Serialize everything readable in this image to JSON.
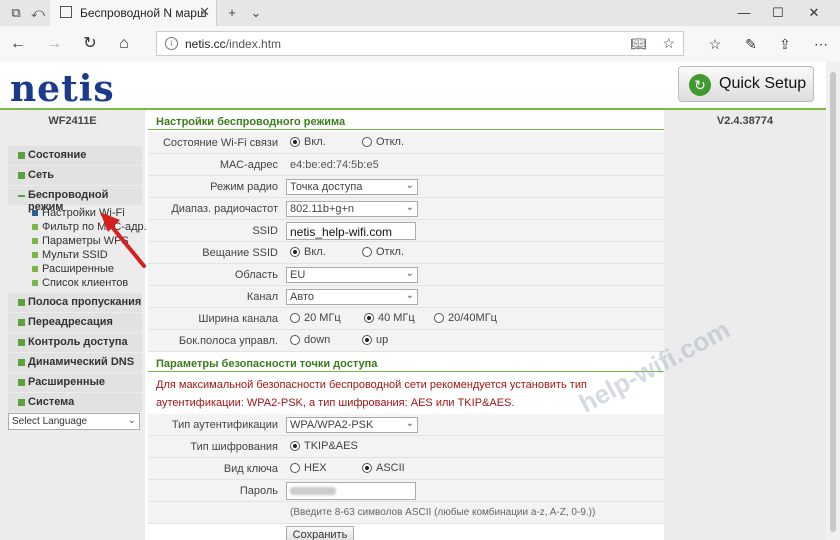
{
  "browser": {
    "tab_title": "Беспроводной N марш",
    "url_host": "netis.cc",
    "url_path": "/index.htm"
  },
  "header": {
    "logo": "netis",
    "quick_setup": "Quick Setup"
  },
  "left": {
    "model": "WF2411E",
    "menu": [
      {
        "label": "Состояние"
      },
      {
        "label": "Сеть"
      },
      {
        "label": "Беспроводной режим"
      },
      {
        "label": "Полоса пропускания"
      },
      {
        "label": "Переадресация"
      },
      {
        "label": "Контроль доступа"
      },
      {
        "label": "Динамический DNS"
      },
      {
        "label": "Расширенные"
      },
      {
        "label": "Система"
      }
    ],
    "submenu": [
      {
        "label": "Настройки Wi-Fi"
      },
      {
        "label": "Фильтр по МАС-адр."
      },
      {
        "label": "Параметры WPS"
      },
      {
        "label": "Мульти SSID"
      },
      {
        "label": "Расширенные"
      },
      {
        "label": "Список клиентов"
      }
    ],
    "language": "Select Language"
  },
  "right": {
    "version": "V2.4.38774"
  },
  "wireless": {
    "title": "Настройки беспроводного режима",
    "state_label": "Состояние Wi-Fi связи",
    "state_on": "Вкл.",
    "state_off": "Откл.",
    "mac_label": "МАС-адрес",
    "mac_value": "e4:be:ed:74:5b:e5",
    "mode_label": "Режим радио",
    "mode_value": "Точка доступа",
    "band_label": "Диапаз. радиочастот",
    "band_value": "802.11b+g+n",
    "ssid_label": "SSID",
    "ssid_value": "netis_help-wifi.com",
    "broadcast_label": "Вещание SSID",
    "broadcast_on": "Вкл.",
    "broadcast_off": "Откл.",
    "region_label": "Область",
    "region_value": "EU",
    "channel_label": "Канал",
    "channel_value": "Авто",
    "width_label": "Ширина канала",
    "width_20": "20 МГц",
    "width_40": "40 МГц",
    "width_2040": "20/40МГц",
    "sideband_label": "Бок.полоса управл.",
    "sideband_down": "down",
    "sideband_up": "up"
  },
  "security": {
    "title": "Параметры безопасности точки доступа",
    "warning": "Для максимальной безопасности беспроводной сети рекомендуется установить тип аутентификации: WPA2-PSK, а тип шифрования: AES или TKIP&AES.",
    "auth_label": "Тип аутентификации",
    "auth_value": "WPA/WPA2-PSK",
    "cipher_label": "Тип шифрования",
    "cipher_value": "TKIP&AES",
    "key_label": "Вид ключа",
    "key_hex": "HEX",
    "key_ascii": "ASCII",
    "password_label": "Пароль",
    "hint": "(Введите 8-63 символов ASCII (любые комбинации a-z, A-Z, 0-9.))",
    "save": "Сохранить"
  },
  "watermark": "help-wifi.com"
}
